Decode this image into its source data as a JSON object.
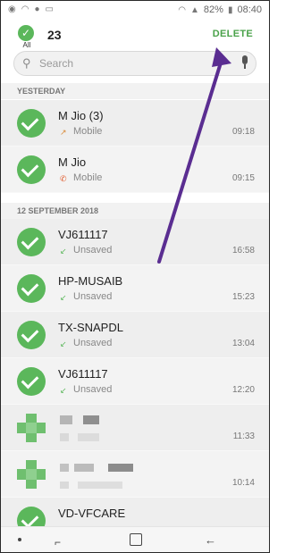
{
  "status_bar": {
    "left_icons": [
      "whatsapp-icon",
      "wifi-icon",
      "location-icon",
      "sim-icon"
    ],
    "battery": "82%",
    "time": "08:40"
  },
  "header": {
    "all_label": "All",
    "selected_count": "23",
    "delete_label": "DELETE"
  },
  "search": {
    "placeholder": "Search"
  },
  "sections": {
    "yesterday": "YESTERDAY",
    "sep12": "12 SEPTEMBER 2018"
  },
  "calls": [
    {
      "name": "M Jio (3)",
      "type": "Mobile",
      "time": "09:18",
      "call_icon": "outgoing-call-icon"
    },
    {
      "name": "M Jio",
      "type": "Mobile",
      "time": "09:15",
      "call_icon": "missed-call-icon"
    },
    {
      "name": "VJ611117",
      "type": "Unsaved",
      "time": "16:58",
      "call_icon": "incoming-call-icon"
    },
    {
      "name": "HP-MUSAIB",
      "type": "Unsaved",
      "time": "15:23",
      "call_icon": "incoming-call-icon"
    },
    {
      "name": "TX-SNAPDL",
      "type": "Unsaved",
      "time": "13:04",
      "call_icon": "incoming-call-icon"
    },
    {
      "name": "VJ611117",
      "type": "Unsaved",
      "time": "12:20",
      "call_icon": "incoming-call-icon"
    },
    {
      "name": "",
      "type": "",
      "time": "11:33",
      "call_icon": "blurred-call-icon"
    },
    {
      "name": "",
      "type": "",
      "time": "10:14",
      "call_icon": "blurred-call-icon"
    },
    {
      "name": "VD-VFCARE",
      "type": "",
      "time": "",
      "call_icon": ""
    }
  ],
  "colors": {
    "accent": "#5bb75b",
    "arrow": "#5a2d91"
  }
}
